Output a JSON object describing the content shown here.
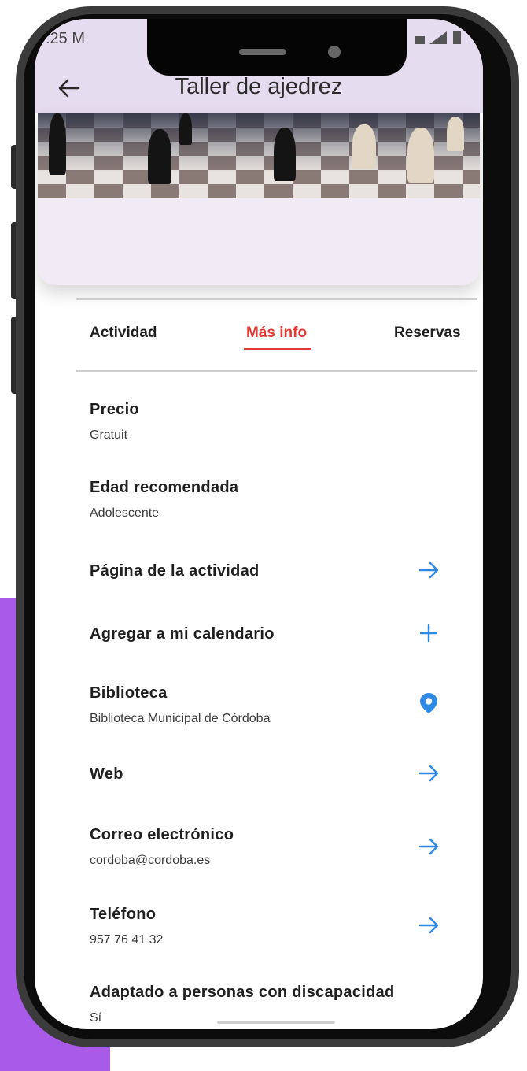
{
  "status": {
    "time": ":25 M"
  },
  "appbar": {
    "title": "Taller de ajedrez",
    "back_icon": "arrow-left-icon"
  },
  "tabs": [
    {
      "label": "Actividad",
      "active": false
    },
    {
      "label": "Más info",
      "active": true
    },
    {
      "label": "Reservas",
      "active": false
    }
  ],
  "info": {
    "precio": {
      "title": "Precio",
      "value": "Gratuit"
    },
    "edad": {
      "title": "Edad recomendada",
      "value": "Adolescente"
    },
    "pagina": {
      "title": "Página de la actividad",
      "icon": "arrow-right-icon"
    },
    "calendario": {
      "title": "Agregar a mi calendario",
      "icon": "plus-icon"
    },
    "biblioteca": {
      "title": "Biblioteca",
      "value": "Biblioteca Municipal de Córdoba",
      "icon": "map-pin-icon"
    },
    "web": {
      "title": "Web",
      "icon": "arrow-right-icon"
    },
    "correo": {
      "title": "Correo electrónico",
      "value": "cordoba@cordoba.es",
      "icon": "arrow-right-icon"
    },
    "telefono": {
      "title": "Teléfono",
      "value": "957 76 41 32",
      "icon": "arrow-right-icon"
    },
    "adaptado": {
      "title": "Adaptado a personas con discapacidad",
      "value": "Sí"
    }
  },
  "colors": {
    "accent": "#e53935",
    "link": "#2f8ae6",
    "appbar": "#e6dcef",
    "frame_bg": "#a95ae8"
  }
}
